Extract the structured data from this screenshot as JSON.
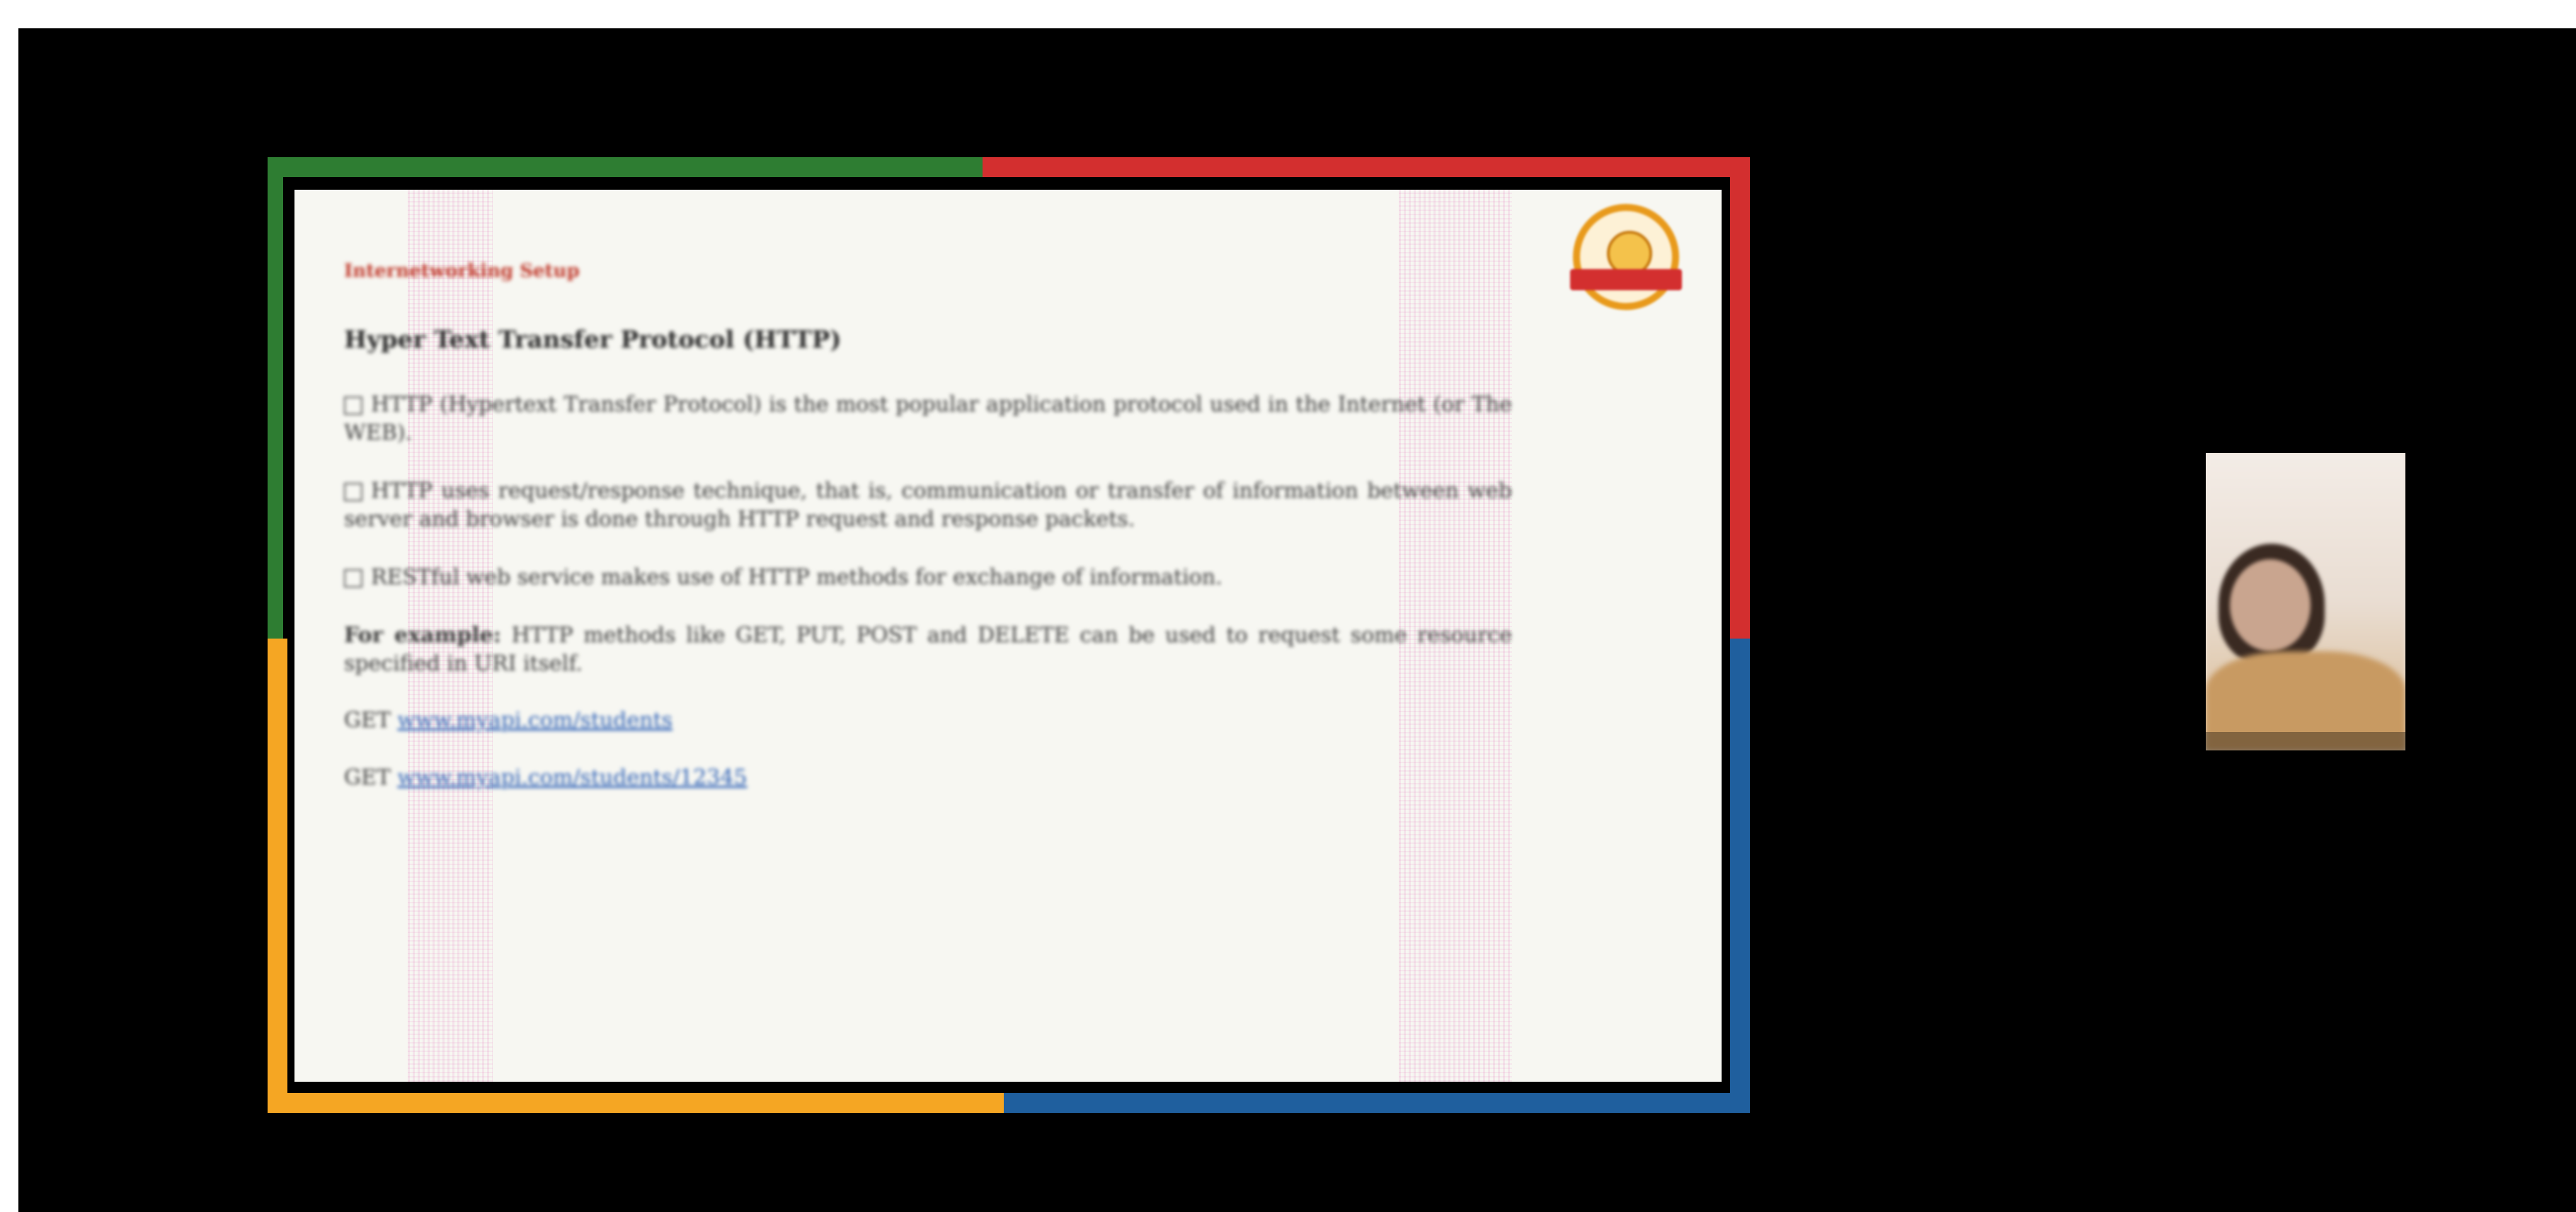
{
  "slide": {
    "section_label": "Internetworking Setup",
    "title": "Hyper Text Transfer Protocol (HTTP)",
    "bullets": [
      "HTTP (Hypertext Transfer Protocol) is the most popular application protocol used in the Internet (or The WEB).",
      "HTTP uses request/response technique, that is, communication or transfer of information between web server and browser is done through HTTP request and response packets.",
      "RESTful web service makes use of HTTP methods for exchange of information."
    ],
    "example_label": "For example:",
    "example_text": "HTTP methods like GET, PUT, POST and DELETE can be used to request some resource specified in URI itself.",
    "links": [
      {
        "method": "GET",
        "url": "www.myapi.com/students"
      },
      {
        "method": "GET",
        "url": "www.myapi.com/students/12345"
      }
    ]
  },
  "icons": {
    "logo": "institution-logo-icon",
    "bullet": "checkbox-bullet-icon"
  },
  "colors": {
    "border_green": "#2e7d32",
    "border_red": "#d32f2f",
    "border_blue": "#1f5f9e",
    "border_orange": "#f5a623",
    "screen_background": "#000000"
  }
}
